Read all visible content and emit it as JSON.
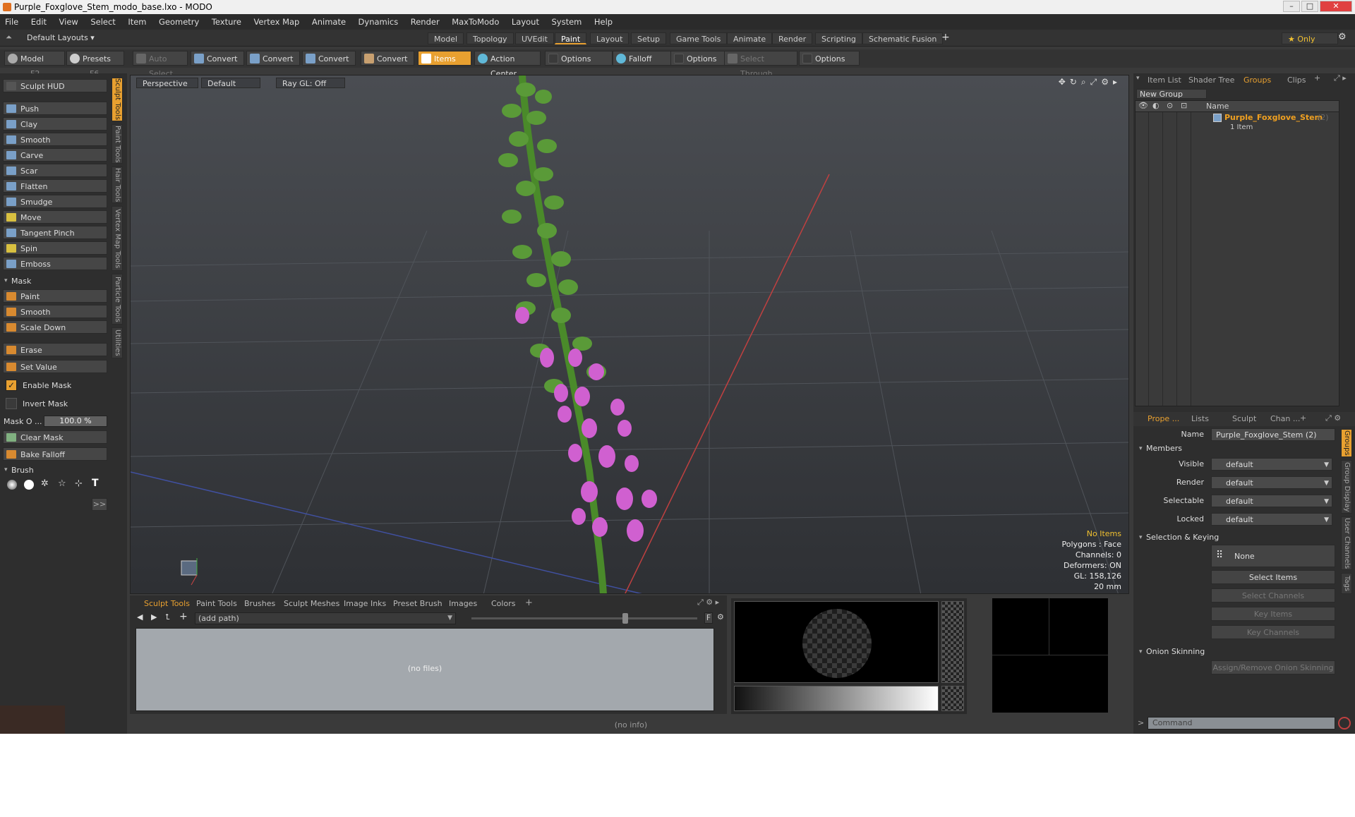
{
  "window": {
    "title": "Purple_Foxglove_Stem_modo_base.lxo - MODO"
  },
  "menu": [
    "File",
    "Edit",
    "View",
    "Select",
    "Item",
    "Geometry",
    "Texture",
    "Vertex Map",
    "Animate",
    "Dynamics",
    "Render",
    "MaxToModo",
    "Layout",
    "System",
    "Help"
  ],
  "layout": {
    "default_layouts": "Default Layouts ▾",
    "tabs": [
      "Model",
      "Topology",
      "UVEdit",
      "Paint",
      "Layout",
      "Setup",
      "Game Tools",
      "Animate",
      "Render",
      "Scripting",
      "Schematic Fusion"
    ],
    "active_tab": "Paint",
    "only_label": "★  Only"
  },
  "toolbar": {
    "model": "Model",
    "model_key": "F2",
    "presets": "Presets",
    "presets_key": "F6",
    "auto_select": "Auto Select",
    "convert": "Convert",
    "items": "Items",
    "action_center": "Action Center",
    "options": "Options",
    "falloff": "Falloff",
    "select_through": "Select Through"
  },
  "left": {
    "hud": "Sculpt HUD",
    "sculpt_tools": [
      "Push",
      "Clay",
      "Smooth",
      "Carve",
      "Scar",
      "Flatten",
      "Smudge",
      "Move",
      "Tangent Pinch",
      "Spin",
      "Emboss"
    ],
    "mask_head": "Mask",
    "mask_tools": [
      "Paint",
      "Smooth",
      "Scale Down"
    ],
    "erase": "Erase",
    "set_value": "Set Value",
    "enable_mask": "Enable Mask",
    "invert_mask": "Invert Mask",
    "mask_opacity_label": "Mask O ...",
    "mask_opacity_value": "100.0 %",
    "clear_mask": "Clear Mask",
    "bake_falloff": "Bake Falloff",
    "brush_head": "Brush",
    "more": ">>",
    "vtabs": [
      "Sculpt Tools",
      "Paint Tools",
      "Hair Tools",
      "Vertex Map Tools",
      "Particle Tools",
      "Utilities"
    ]
  },
  "viewport": {
    "perspective": "Perspective",
    "default": "Default",
    "raygl": "Ray GL: Off",
    "info": {
      "items": "No Items",
      "polygons": "Polygons : Face",
      "channels": "Channels: 0",
      "deformers": "Deformers: ON",
      "gl": "GL: 158,126",
      "scale": "20 mm"
    }
  },
  "bottom": {
    "tabs": [
      "Sculpt Tools",
      "Paint Tools",
      "Brushes",
      "Sculpt Meshes",
      "Image Inks",
      "Preset Brush",
      "Images",
      "Colors"
    ],
    "path": "(add path)",
    "nofiles": "(no files)",
    "noinfo": "(no info)",
    "f_label": "F"
  },
  "right": {
    "top_tabs": [
      "Item List",
      "Shader Tree",
      "Groups",
      "Clips"
    ],
    "new_group": "New Group",
    "col_name": "Name",
    "group_name": "Purple_Foxglove_Stem",
    "group_count": "(2)",
    "group_items": "1 Item",
    "prop_tabs": [
      "Prope ...",
      "Lists",
      "Sculpt",
      "Chan ..."
    ],
    "name_label": "Name",
    "name_value": "Purple_Foxglove_Stem (2)",
    "members": "Members",
    "visible": "Visible",
    "render": "Render",
    "selectable": "Selectable",
    "locked": "Locked",
    "default": "default",
    "sel_keying": "Selection & Keying",
    "none": "None",
    "select_items": "Select Items",
    "select_channels": "Select Channels",
    "key_items": "Key Items",
    "key_channels": "Key Channels",
    "onion": "Onion Skinning",
    "assign_onion": "Assign/Remove Onion Skinning",
    "command": "Command",
    "side_tabs": [
      "Groups",
      "Group Display",
      "User Channels",
      "Tags"
    ]
  },
  "colors": {
    "accent": "#e8a030"
  }
}
